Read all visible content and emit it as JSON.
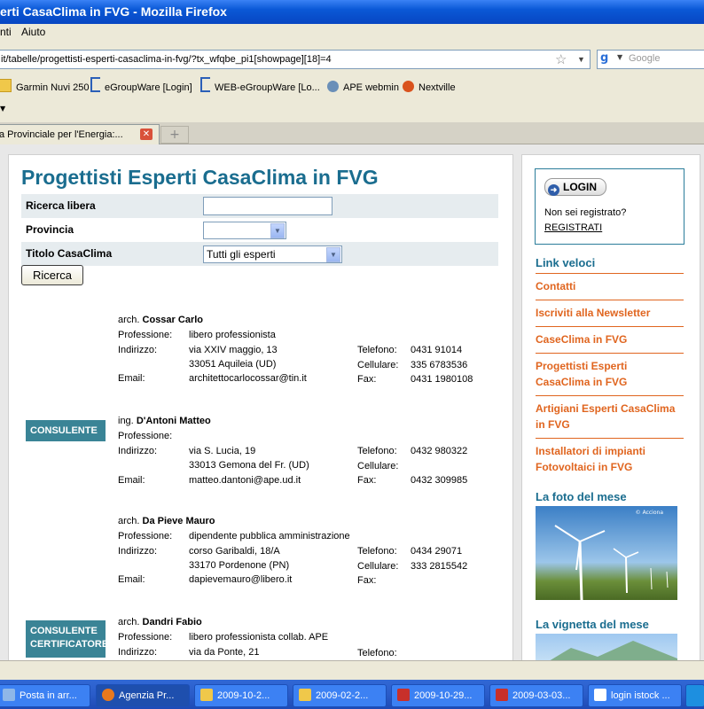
{
  "window": {
    "title": "erti CasaClima in FVG - Mozilla Firefox"
  },
  "menu": {
    "items": [
      "nti",
      "Aiuto"
    ]
  },
  "nav": {
    "url": "it/tabelle/progettisti-esperti-casaclima-in-fvg/?tx_wfqbe_pi1[showpage][18]=4",
    "search_placeholder": "Google"
  },
  "bookmarks": [
    "Garmin Nuvi 250",
    "eGroupWare [Login]",
    "WEB-eGroupWare [Lo...",
    "APE webmin",
    "Nextville"
  ],
  "tabs": [
    {
      "label": "a Provinciale per l'Energia:..."
    }
  ],
  "page": {
    "title": "Progettisti Esperti CasaClima in FVG",
    "form": {
      "ricerca_label": "Ricerca libera",
      "provincia_label": "Provincia",
      "titolo_label": "Titolo CasaClima",
      "titolo_value": "Tutti gli esperti",
      "button": "Ricerca"
    },
    "field_labels": {
      "professione": "Professione:",
      "indirizzo": "Indirizzo:",
      "email": "Email:",
      "telefono": "Telefono:",
      "cellulare": "Cellulare:",
      "fax": "Fax:"
    },
    "entries": [
      {
        "title": "arch.",
        "name": "Cossar Carlo",
        "badge": "",
        "professione": "libero professionista",
        "indirizzo1": "via XXIV maggio, 13",
        "indirizzo2": "33051 Aquileia (UD)",
        "email": "architettocarlocossar@tin.it",
        "telefono": "0431 91014",
        "cellulare": "335 6783536",
        "fax": "0431 1980108"
      },
      {
        "title": "ing.",
        "name": "D'Antoni Matteo",
        "badge": "CONSULENTE",
        "professione": "",
        "indirizzo1": "via S. Lucia, 19",
        "indirizzo2": "33013 Gemona del Fr. (UD)",
        "email": "matteo.dantoni@ape.ud.it",
        "telefono": "0432 980322",
        "cellulare": "",
        "fax": "0432 309985"
      },
      {
        "title": "arch.",
        "name": "Da Pieve Mauro",
        "badge": "",
        "professione": "dipendente pubblica amministrazione",
        "indirizzo1": "corso Garibaldi, 18/A",
        "indirizzo2": "33170 Pordenone (PN)",
        "email": "dapievemauro@libero.it",
        "telefono": "0434 29071",
        "cellulare": "333 2815542",
        "fax": ""
      },
      {
        "title": "arch.",
        "name": "Dandri Fabio",
        "badge": "CONSULENTE CERTIFICATORE",
        "professione": "libero professionista collab. APE",
        "indirizzo1": "via da Ponte, 21",
        "indirizzo2": "",
        "email": "",
        "telefono": "",
        "cellulare": "",
        "fax": ""
      }
    ]
  },
  "sidebar": {
    "login_label": "LOGIN",
    "not_registered": "Non sei registrato?",
    "register_link": "REGISTRATI",
    "links_heading": "Link veloci",
    "links": [
      "Contatti",
      "Iscriviti alla Newsletter",
      "CaseClima in FVG",
      "Progettisti Esperti CasaClima in FVG",
      "Artigiani Esperti CasaClima in FVG",
      "Installatori di impianti Fotovoltaici in FVG"
    ],
    "foto_heading": "La foto del mese",
    "foto_credit": "© Acciona",
    "vignetta_heading": "La vignetta del mese"
  },
  "taskbar": {
    "items": [
      "Posta in arr...",
      "Agenzia Pr...",
      "2009-10-2...",
      "2009-02-2...",
      "2009-10-29...",
      "2009-03-03...",
      "login istock ..."
    ]
  },
  "colors": {
    "accent": "#1a6d8f",
    "link": "#e0651f",
    "badge": "#3a8496"
  }
}
